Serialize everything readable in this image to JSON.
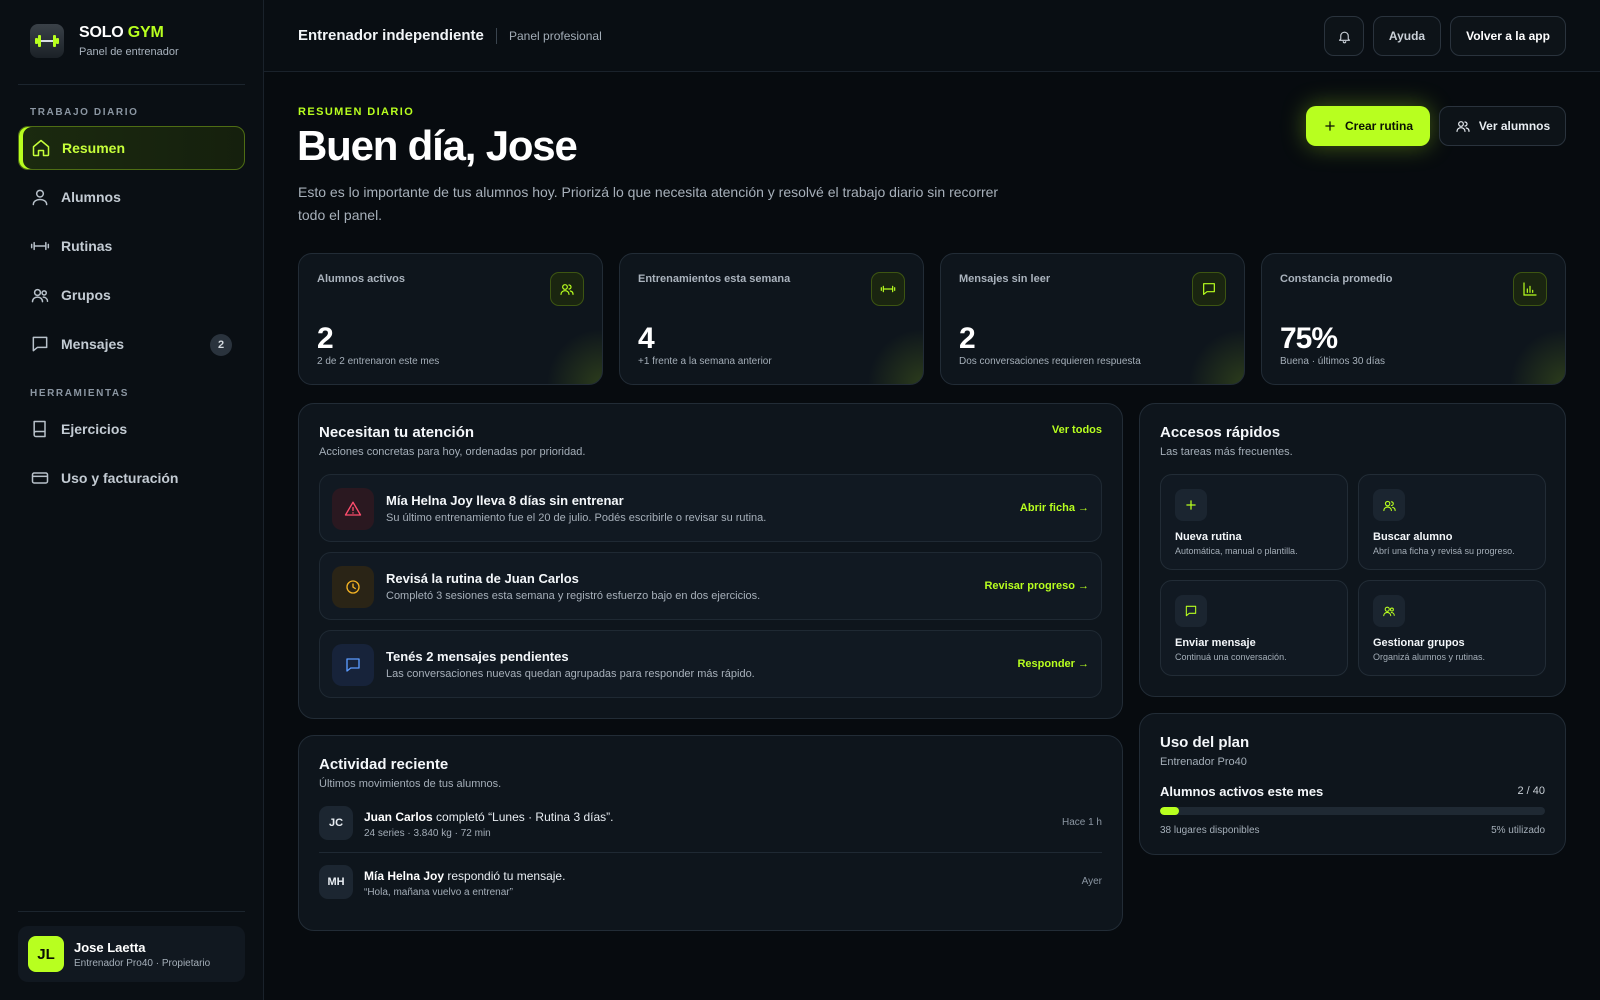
{
  "brand": {
    "name_part1": "SOLO",
    "name_part2": "GYM",
    "subtitle": "Panel de entrenador",
    "accent_color": "#b8ff1f"
  },
  "sidebar": {
    "section_daily": "TRABAJO DIARIO",
    "section_tools": "HERRAMIENTAS",
    "items": [
      {
        "label": "Resumen",
        "icon": "home-icon",
        "active": true
      },
      {
        "label": "Alumnos",
        "icon": "user-icon"
      },
      {
        "label": "Rutinas",
        "icon": "dumbbell-icon"
      },
      {
        "label": "Grupos",
        "icon": "users-icon"
      },
      {
        "label": "Mensajes",
        "icon": "message-icon",
        "badge": "2"
      }
    ],
    "tools": [
      {
        "label": "Ejercicios",
        "icon": "book-icon"
      },
      {
        "label": "Uso y facturación",
        "icon": "credit-card-icon"
      }
    ],
    "user": {
      "initials": "JL",
      "name": "Jose Laetta",
      "role": "Entrenador Pro40 · Propietario"
    }
  },
  "topbar": {
    "title": "Entrenador independiente",
    "subtitle": "Panel profesional",
    "help_label": "Ayuda",
    "back_label": "Volver a la app"
  },
  "hero": {
    "eyebrow": "RESUMEN DIARIO",
    "title": "Buen día, Jose",
    "description": "Esto es lo importante de tus alumnos hoy. Priorizá lo que necesita atención y resolvé el trabajo diario sin recorrer todo el panel.",
    "primary_label": "Crear rutina",
    "secondary_label": "Ver alumnos"
  },
  "stats": [
    {
      "label": "Alumnos activos",
      "value": "2",
      "note": "2 de 2 entrenaron este mes",
      "icon": "user-icon"
    },
    {
      "label": "Entrenamientos esta semana",
      "value": "4",
      "note": "+1 frente a la semana anterior",
      "icon": "dumbbell-icon"
    },
    {
      "label": "Mensajes sin leer",
      "value": "2",
      "note": "Dos conversaciones requieren respuesta",
      "icon": "message-icon"
    },
    {
      "label": "Constancia promedio",
      "value": "75%",
      "note": "Buena · últimos 30 días",
      "icon": "bar-chart-icon"
    }
  ],
  "attention": {
    "title": "Necesitan tu atención",
    "subtitle": "Acciones concretas para hoy, ordenadas por prioridad.",
    "link": "Ver todos",
    "items": [
      {
        "title": "Mía Helna Joy lleva 8 días sin entrenar",
        "desc": "Su último entrenamiento fue el 20 de julio. Podés escribirle o revisar su rutina.",
        "action": "Abrir ficha →",
        "icon": "warning-icon",
        "color": "#ff4d6d"
      },
      {
        "title": "Revisá la rutina de Juan Carlos",
        "desc": "Completó 3 sesiones esta semana y registró esfuerzo bajo en dos ejercicios.",
        "action": "Revisar progreso →",
        "icon": "clock-icon",
        "color": "#f5b324"
      },
      {
        "title": "Tenés 2 mensajes pendientes",
        "desc": "Las conversaciones nuevas quedan agrupadas para responder más rápido.",
        "action": "Responder →",
        "icon": "message-icon",
        "color": "#5b9bff"
      }
    ]
  },
  "activity": {
    "title": "Actividad reciente",
    "subtitle": "Últimos movimientos de tus alumnos.",
    "items": [
      {
        "initials": "JC",
        "name": "Juan Carlos",
        "text": " completó “Lunes · Rutina 3 días”.",
        "meta": "24 series · 3.840 kg · 72 min",
        "time": "Hace 1 h"
      },
      {
        "initials": "MH",
        "name": "Mía Helna Joy",
        "text": " respondió tu mensaje.",
        "meta": "“Hola, mañana vuelvo a entrenar”",
        "time": "Ayer"
      }
    ]
  },
  "quick": {
    "title": "Accesos rápidos",
    "subtitle": "Las tareas más frecuentes.",
    "items": [
      {
        "title": "Nueva rutina",
        "desc": "Automática, manual o plantilla.",
        "icon": "plus-icon"
      },
      {
        "title": "Buscar alumno",
        "desc": "Abrí una ficha y revisá su progreso.",
        "icon": "user-search-icon"
      },
      {
        "title": "Enviar mensaje",
        "desc": "Continuá una conversación.",
        "icon": "message-icon"
      },
      {
        "title": "Gestionar grupos",
        "desc": "Organizá alumnos y rutinas.",
        "icon": "users-icon"
      }
    ]
  },
  "plan": {
    "title": "Uso del plan",
    "subtitle": "Entrenador Pro40",
    "metric_label": "Alumnos activos este mes",
    "count": "2 / 40",
    "used_fraction": 0.05,
    "available": "38 lugares disponibles",
    "used_label": "5% utilizado"
  }
}
